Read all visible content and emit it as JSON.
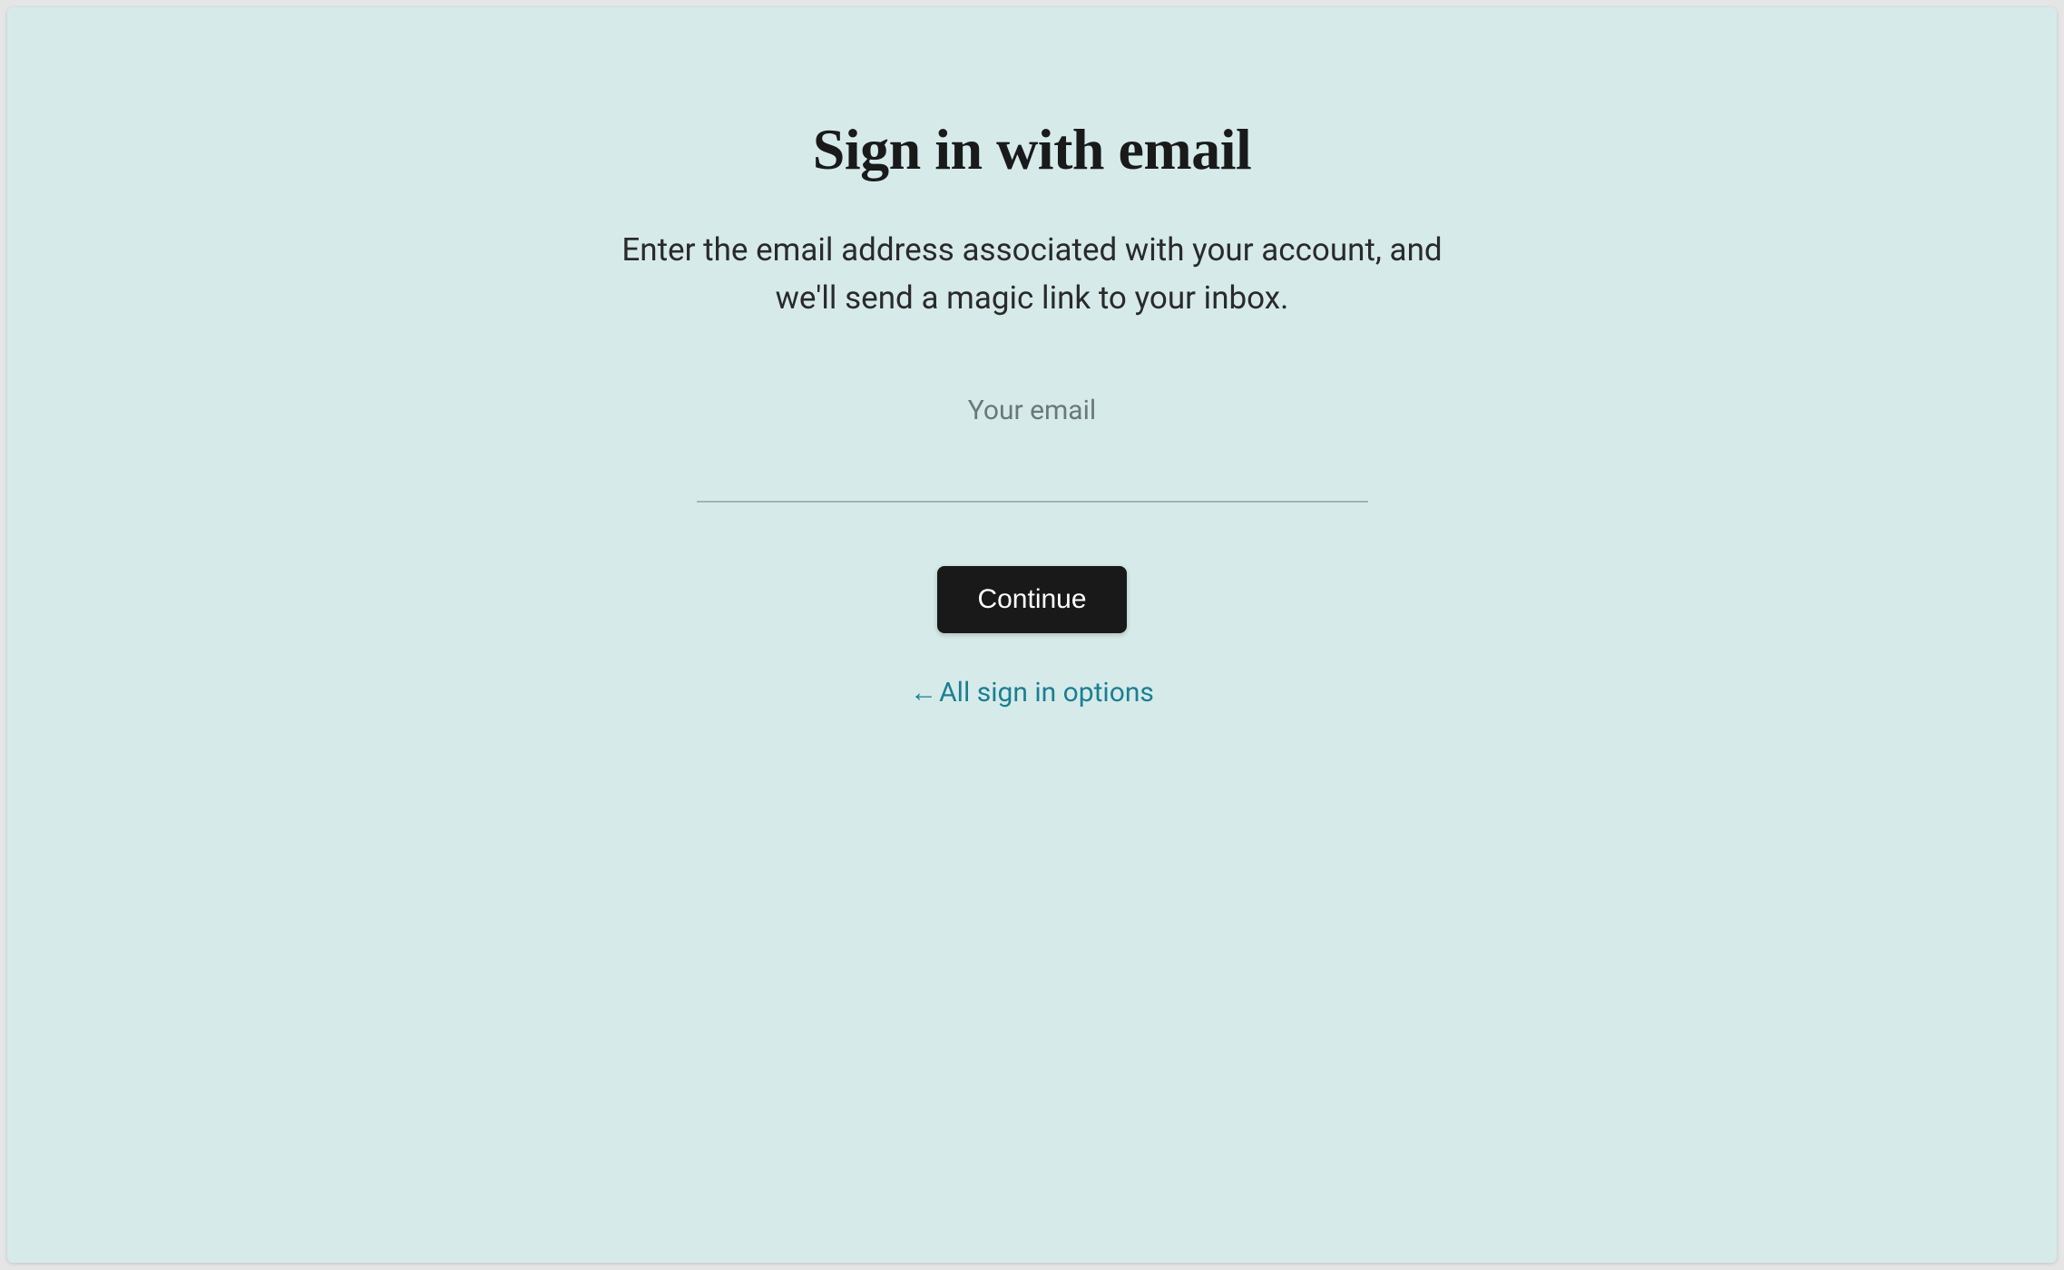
{
  "title": "Sign in with email",
  "subtitle": "Enter the email address associated with your account, and we'll send a magic link to your inbox.",
  "form": {
    "email_label": "Your email",
    "email_value": "",
    "continue_label": "Continue"
  },
  "back_link": {
    "arrow": "←",
    "label": "All sign in options"
  },
  "colors": {
    "background": "#d6eaea",
    "button_bg": "#191919",
    "button_text": "#ffffff",
    "link": "#1a7f91",
    "label": "#6b7878",
    "text": "#2a2a2a",
    "title": "#1a1a1a"
  }
}
